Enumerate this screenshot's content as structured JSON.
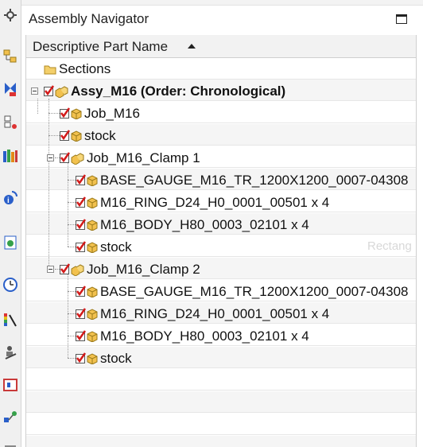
{
  "window": {
    "title": "Assembly Navigator"
  },
  "navigator": {
    "column_header": "Descriptive Part Name",
    "rows": [
      {
        "label": "Sections"
      },
      {
        "label": "Assy_M16 (Order: Chronological)"
      },
      {
        "label": "Job_M16"
      },
      {
        "label": "stock"
      },
      {
        "label": "Job_M16_Clamp 1"
      },
      {
        "label": "BASE_GAUGE_M16_TR_1200X1200_0007-04308"
      },
      {
        "label": "M16_RING_D24_H0_0001_00501 x 4"
      },
      {
        "label": "M16_BODY_H80_0003_02101 x 4"
      },
      {
        "label": "stock"
      },
      {
        "label": "Job_M16_Clamp 2"
      },
      {
        "label": "BASE_GAUGE_M16_TR_1200X1200_0007-04308"
      },
      {
        "label": "M16_RING_D24_H0_0001_00501 x 4"
      },
      {
        "label": "M16_BODY_H80_0003_02101 x 4"
      },
      {
        "label": "stock"
      }
    ]
  },
  "background_hint": "Rectang",
  "colors": {
    "check_red": "#d21a1a",
    "cube_yellow": "#f2c14e",
    "folder_yellow": "#f3cf6a"
  }
}
